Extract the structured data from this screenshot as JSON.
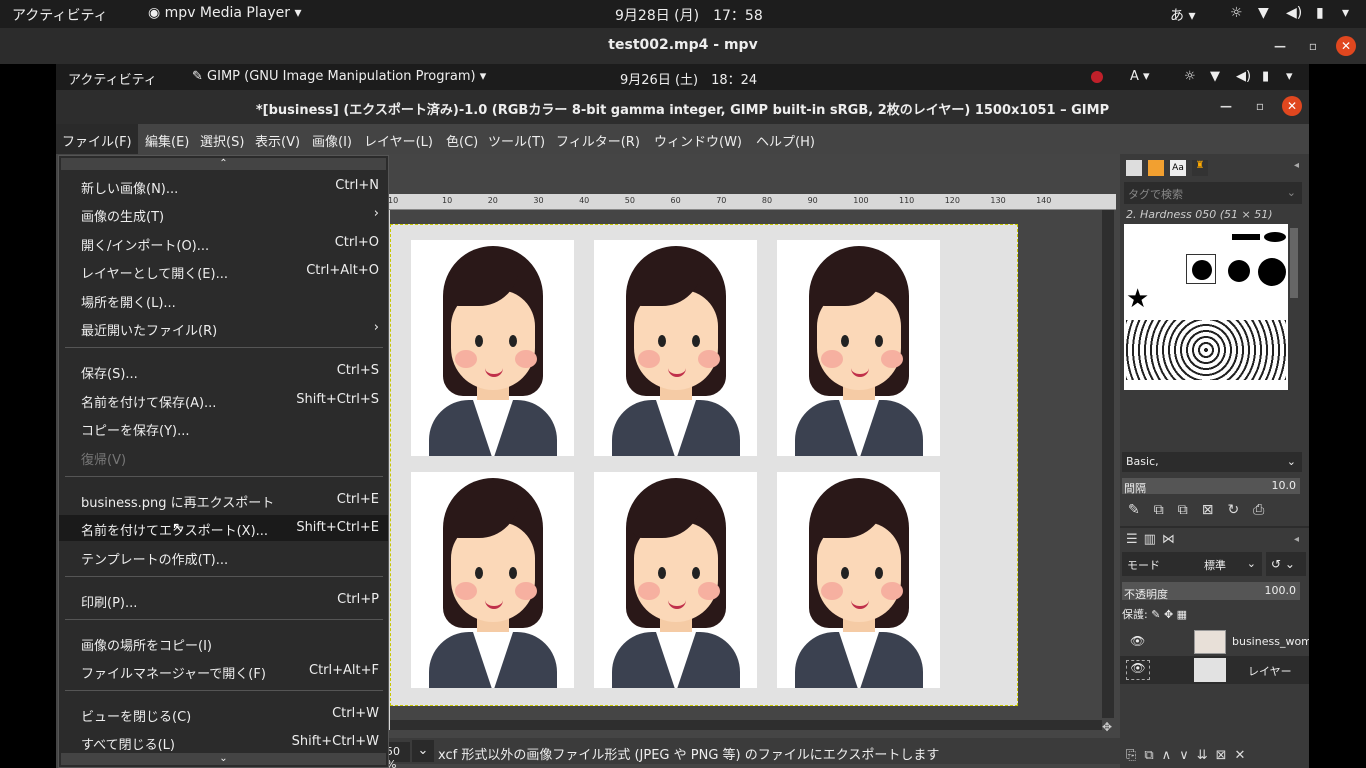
{
  "topbar": {
    "activities": "アクティビティ",
    "app": "mpv Media Player",
    "clock": "9月28日 (月)　17：58",
    "ime": "あ"
  },
  "mpv": {
    "title": "test002.mp4 - mpv"
  },
  "inner": {
    "activities": "アクティビティ",
    "app": "GIMP (GNU Image Manipulation Program)",
    "clock": "9月26日 (土)　18：24",
    "ime": "A"
  },
  "gimp": {
    "title": "*[business] (エクスポート済み)-1.0 (RGBカラー 8-bit gamma integer, GIMP built-in sRGB, 2枚のレイヤー) 1500x1051 – GIMP",
    "menus": [
      "ファイル(F)",
      "編集(E)",
      "選択(S)",
      "表示(V)",
      "画像(I)",
      "レイヤー(L)",
      "色(C)",
      "ツール(T)",
      "フィルター(R)",
      "ウィンドウ(W)",
      "ヘルプ(H)"
    ],
    "status": {
      "zoom": "50 %",
      "message": "xcf 形式以外の画像ファイル形式 (JPEG や PNG 等) のファイルにエクスポートします"
    },
    "ruler": [
      "10",
      "20",
      "30",
      "40",
      "50",
      "60",
      "70",
      "80",
      "90",
      "100",
      "110",
      "120",
      "130",
      "140"
    ]
  },
  "filemenu": [
    {
      "label": "新しい画像(N)...",
      "shortcut": "Ctrl+N"
    },
    {
      "label": "画像の生成(T)",
      "shortcut": "›"
    },
    {
      "label": "開く/インポート(O)...",
      "shortcut": "Ctrl+O"
    },
    {
      "label": "レイヤーとして開く(E)...",
      "shortcut": "Ctrl+Alt+O"
    },
    {
      "label": "場所を開く(L)...",
      "shortcut": ""
    },
    {
      "label": "最近開いたファイル(R)",
      "shortcut": "›"
    },
    {
      "label": "保存(S)...",
      "shortcut": "Ctrl+S"
    },
    {
      "label": "名前を付けて保存(A)...",
      "shortcut": "Shift+Ctrl+S"
    },
    {
      "label": "コピーを保存(Y)...",
      "shortcut": ""
    },
    {
      "label": "復帰(V)",
      "shortcut": ""
    },
    {
      "label": "business.png に再エクスポート",
      "shortcut": "Ctrl+E"
    },
    {
      "label": "名前を付けてエクスポート(X)...",
      "shortcut": "Shift+Ctrl+E"
    },
    {
      "label": "テンプレートの作成(T)...",
      "shortcut": ""
    },
    {
      "label": "印刷(P)...",
      "shortcut": "Ctrl+P"
    },
    {
      "label": "画像の場所をコピー(I)",
      "shortcut": ""
    },
    {
      "label": "ファイルマネージャーで開く(F)",
      "shortcut": "Ctrl+Alt+F"
    },
    {
      "label": "ビューを閉じる(C)",
      "shortcut": "Ctrl+W"
    },
    {
      "label": "すべて閉じる(L)",
      "shortcut": "Shift+Ctrl+W"
    }
  ],
  "brushes": {
    "search_placeholder": "タグで検索",
    "brush_name": "2. Hardness 050 (51 × 51)",
    "preset": "Basic,",
    "spacing_label": "間隔",
    "spacing_value": "10.0"
  },
  "layers": {
    "mode_label": "モード",
    "mode_value": "標準",
    "opacity_label": "不透明度",
    "opacity_value": "100.0",
    "lock_label": "保護:",
    "items": [
      {
        "name": "business_wom"
      },
      {
        "name": "レイヤー"
      }
    ]
  }
}
